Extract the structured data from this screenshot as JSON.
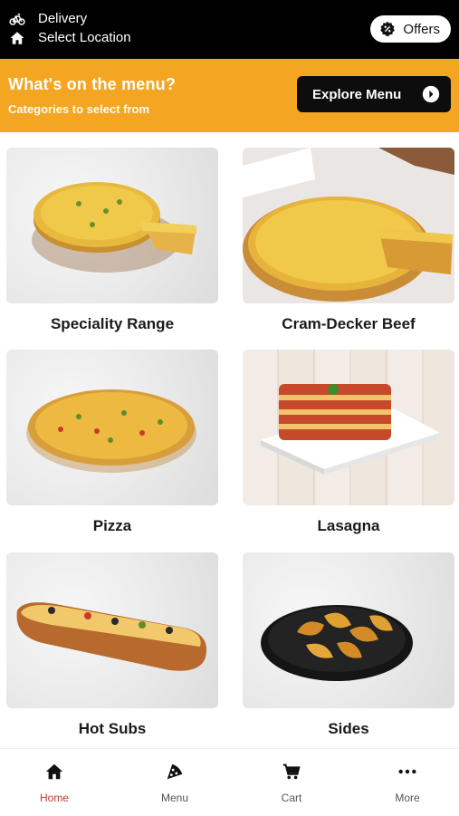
{
  "header": {
    "delivery_label": "Delivery",
    "location_label": "Select Location",
    "offers_label": "Offers"
  },
  "banner": {
    "title": "What's on the menu?",
    "subtitle": "Categories to select from",
    "explore_label": "Explore Menu"
  },
  "categories": [
    {
      "label": "Speciality Range"
    },
    {
      "label": "Cram-Decker Beef"
    },
    {
      "label": "Pizza"
    },
    {
      "label": "Lasagna"
    },
    {
      "label": "Hot Subs"
    },
    {
      "label": "Sides"
    }
  ],
  "nav": [
    {
      "label": "Home"
    },
    {
      "label": "Menu"
    },
    {
      "label": "Cart"
    },
    {
      "label": "More"
    }
  ],
  "colors": {
    "accent": "#f4a623",
    "active_nav": "#c0392b",
    "topbar": "#000000"
  }
}
